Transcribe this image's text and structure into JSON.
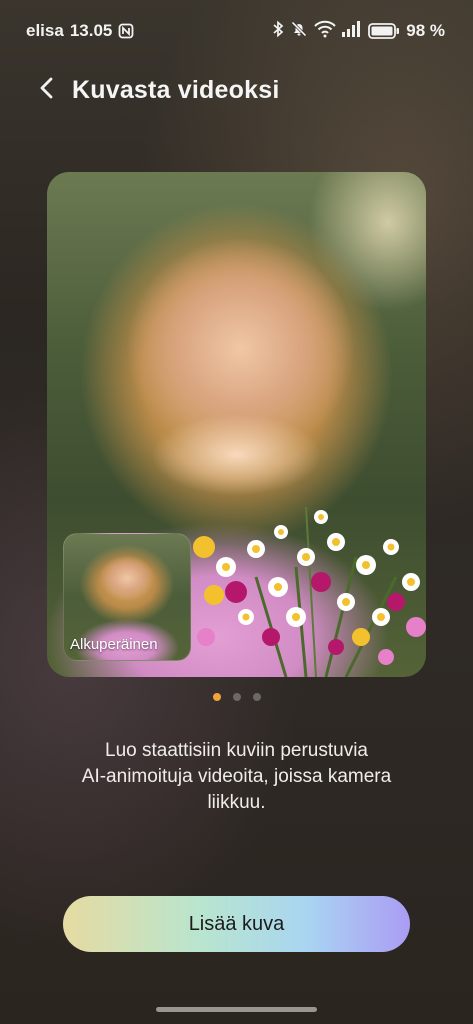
{
  "status_bar": {
    "carrier": "elisa",
    "time": "13.05",
    "battery_percent": "98 %",
    "icons": [
      "nfc-icon",
      "bluetooth-icon",
      "silent-icon",
      "wifi-icon",
      "signal-icon",
      "battery-icon"
    ]
  },
  "header": {
    "back_icon": "chevron-left-icon",
    "title": "Kuvasta videoksi"
  },
  "preview": {
    "thumbnail_label": "Alkuperäinen",
    "pages": 3,
    "active_page": 1
  },
  "description": {
    "line1": "Luo staattisiin kuviin perustuvia",
    "line2": "AI-animoituja videoita, joissa kamera",
    "line3": "liikkuu."
  },
  "primary_button": {
    "label": "Lisää kuva"
  },
  "colors": {
    "accent_dot": "#f2a43a",
    "button_gradient": [
      "#e6dba2",
      "#b8e5cf",
      "#a9d5f1",
      "#aa9cf4"
    ]
  }
}
